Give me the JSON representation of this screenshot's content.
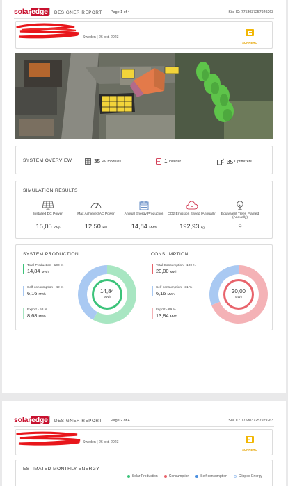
{
  "brand": {
    "logo_solar": "solar",
    "logo_edge": "edge",
    "report_title": "DESIGNER REPORT",
    "site_id": "Site ID: 7758037257929263",
    "sunhero": "SUNHERO"
  },
  "page1": {
    "page_label": "Page 1 of 4",
    "info": "Sweden  |  26 okt. 2023",
    "overview": {
      "title": "SYSTEM OVERVIEW",
      "pv_count": "35",
      "pv_label": "PV modules",
      "inverter_count": "1",
      "inverter_label": "Inverter",
      "optimizer_count": "35",
      "optimizer_label": "Optimizers"
    },
    "simulation": {
      "title": "SIMULATION RESULTS",
      "metrics": [
        {
          "icon": "solar-panel-icon",
          "label": "Installed DC Power",
          "value": "15,05",
          "unit": "kWp"
        },
        {
          "icon": "gauge-icon",
          "label": "Max Achieved AC Power",
          "value": "12,50",
          "unit": "kW"
        },
        {
          "icon": "calendar-icon",
          "label": "Annual Energy Production",
          "value": "14,84",
          "unit": "MWh"
        },
        {
          "icon": "cloud-co2-icon",
          "label": "CO2 Emission Saved (Annually)",
          "value": "192,93",
          "unit": "kg"
        },
        {
          "icon": "tree-icon",
          "label": "Equivalent Trees Planted (Annually)",
          "value": "9",
          "unit": ""
        }
      ]
    },
    "production": {
      "title": "SYSTEM PRODUCTION",
      "total_label": "Total Production - 100 %",
      "total_value": "14,84",
      "total_unit": "MWh",
      "self_label": "Self-consumption - 42 %",
      "self_value": "6,16",
      "self_unit": "MWh",
      "export_label": "Export - 58 %",
      "export_value": "8,68",
      "export_unit": "MWh",
      "center_value": "14,84",
      "center_unit": "MWh",
      "self_fraction": 0.42,
      "export_fraction": 0.58
    },
    "consumption": {
      "title": "CONSUMPTION",
      "total_label": "Total Consumption - 100 %",
      "total_value": "20,00",
      "total_unit": "MWh",
      "self_label": "Self-consumption - 31 %",
      "self_value": "6,16",
      "self_unit": "MWh",
      "import_label": "Import - 69 %",
      "import_value": "13,84",
      "import_unit": "MWh",
      "center_value": "20,00",
      "center_unit": "MWh",
      "self_fraction": 0.31,
      "import_fraction": 0.69
    }
  },
  "page2": {
    "page_label": "Page 2 of 4",
    "info": "Sweden  |  26 okt. 2023",
    "title": "ESTIMATED MONTHLY ENERGY",
    "legend": [
      "Solar Production",
      "Consumption",
      "Self-consumption",
      "Clipped Energy"
    ]
  },
  "colors": {
    "brand_red": "#c8102e",
    "production_green": "#3cc37a",
    "self_blue": "#a9c9f2",
    "export_green": "#a8e6c2",
    "consumption_red": "#e8636b",
    "import_pink": "#f4b2b6",
    "sunhero_yellow": "#e6a400"
  }
}
